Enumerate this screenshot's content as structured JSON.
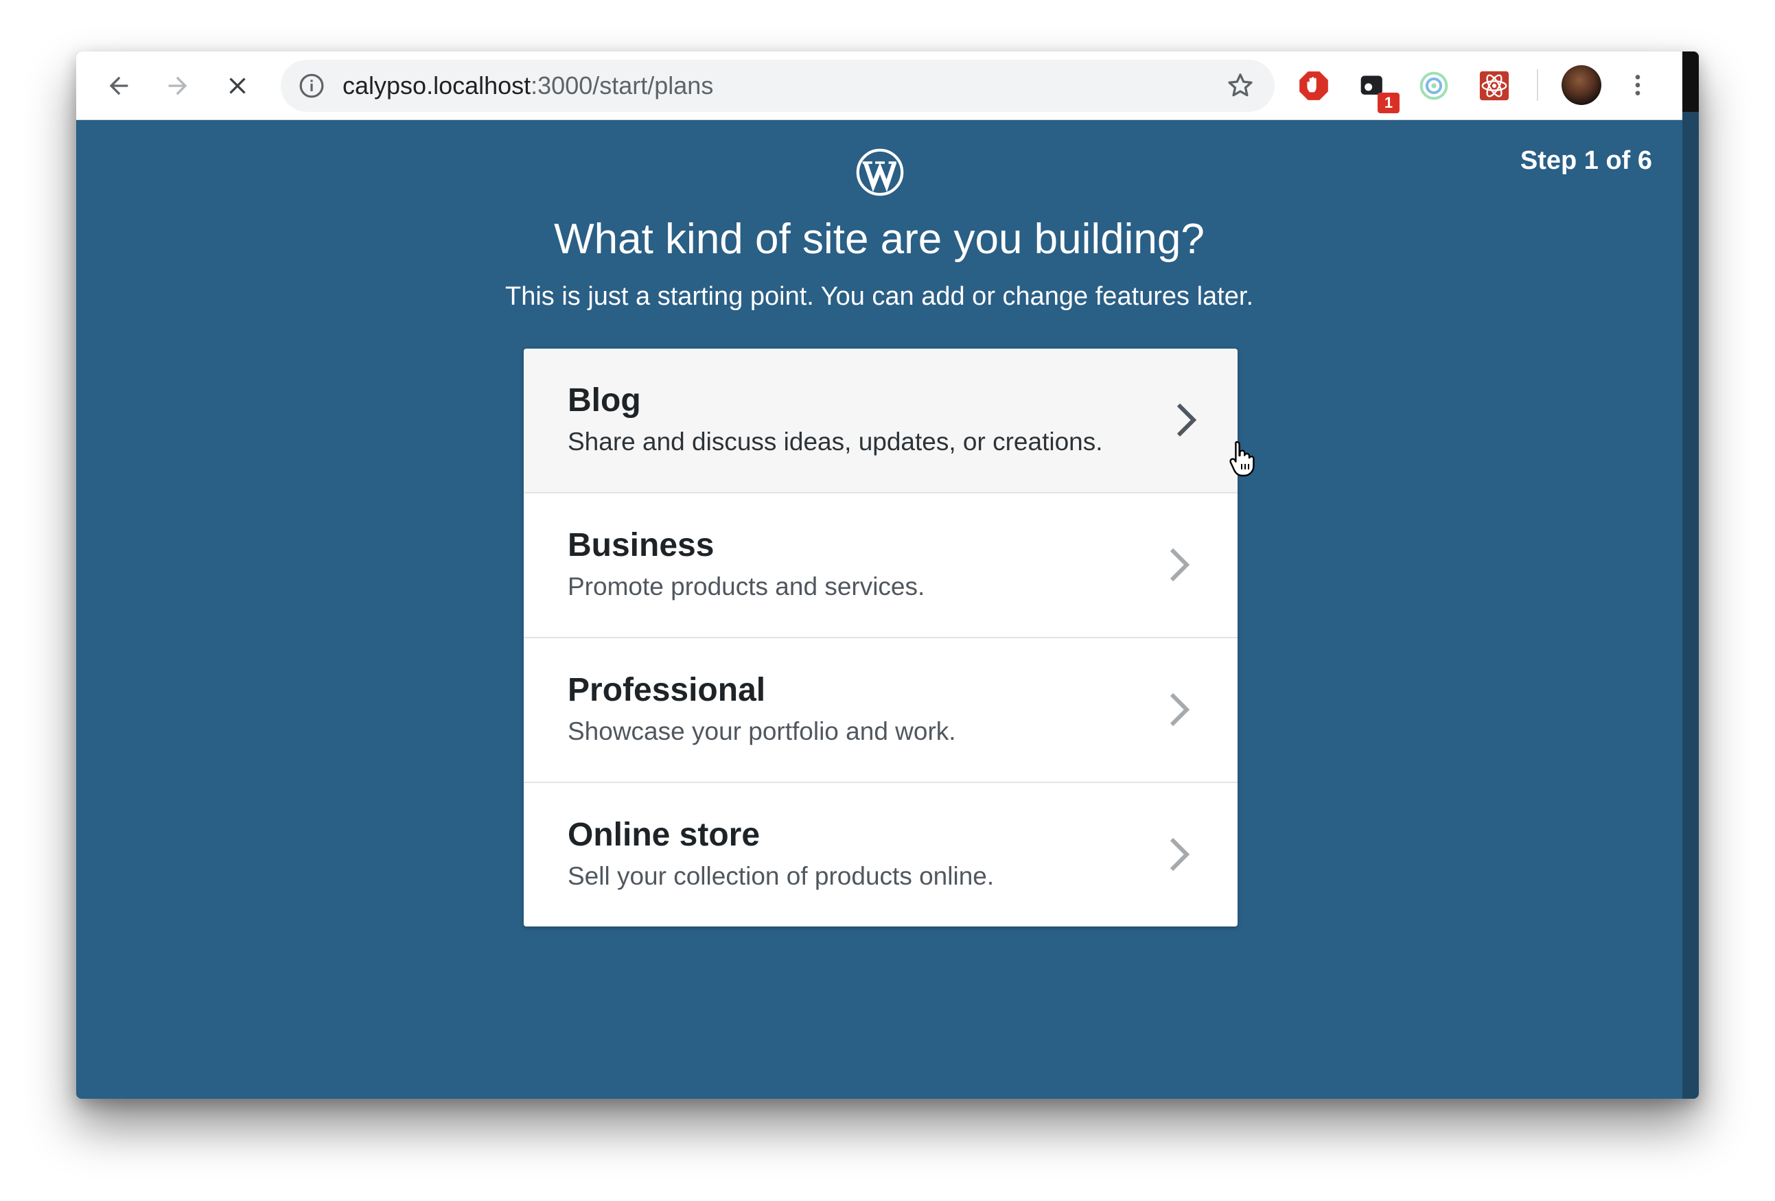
{
  "browser": {
    "url_host": "calypso.localhost",
    "url_rest": ":3000/start/plans",
    "extension_badge": "1"
  },
  "header": {
    "step": "Step 1 of 6",
    "title": "What kind of site are you building?",
    "subtitle": "This is just a starting point. You can add or change features later."
  },
  "site_types": [
    {
      "label": "Blog",
      "description": "Share and discuss ideas, updates, or creations."
    },
    {
      "label": "Business",
      "description": "Promote products and services."
    },
    {
      "label": "Professional",
      "description": "Showcase your portfolio and work."
    },
    {
      "label": "Online store",
      "description": "Sell your collection of products online."
    }
  ],
  "colors": {
    "background": "#2a5f86",
    "card": "#ffffff",
    "card_hover": "#f6f6f6",
    "title_text": "#1e2327",
    "description_text": "#50575e"
  },
  "icons": {
    "back": "arrow-left-icon",
    "forward": "arrow-right-icon",
    "stop": "close-icon",
    "site_info": "info-icon",
    "bookmark": "star-icon",
    "logo": "wordpress-logo-icon",
    "chevron": "chevron-right-icon"
  }
}
